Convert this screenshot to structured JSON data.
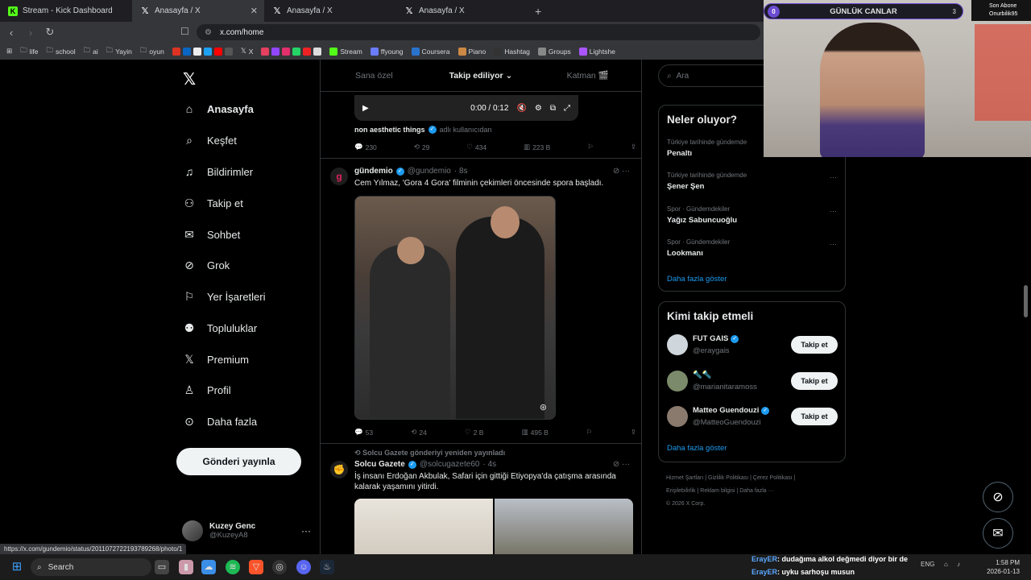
{
  "browser": {
    "tabs": [
      {
        "title": "Stream - Kick Dashboard",
        "icon": "kick-icon",
        "active": false
      },
      {
        "title": "Anasayfa / X",
        "icon": "x-icon",
        "active": true
      },
      {
        "title": "Anasayfa / X",
        "icon": "x-icon",
        "active": false
      },
      {
        "title": "Anasayfa / X",
        "icon": "x-icon",
        "active": false
      }
    ],
    "url": "x.com/home",
    "bookmarks": [
      "life",
      "school",
      "ai",
      "Yayin",
      "oyun",
      "X",
      "Stream",
      "ffyoung",
      "Coursera",
      "Piano",
      "Hashtag",
      "Groups",
      "Lightshe"
    ]
  },
  "nav": {
    "items": [
      {
        "label": "Anasayfa",
        "icon": "home-icon",
        "active": true
      },
      {
        "label": "Keşfet",
        "icon": "search-icon",
        "active": false
      },
      {
        "label": "Bildirimler",
        "icon": "bell-icon",
        "active": false
      },
      {
        "label": "Takip et",
        "icon": "add-person-icon",
        "active": false
      },
      {
        "label": "Sohbet",
        "icon": "mail-icon",
        "active": false
      },
      {
        "label": "Grok",
        "icon": "grok-icon",
        "active": false
      },
      {
        "label": "Yer İşaretleri",
        "icon": "bookmark-icon",
        "active": false
      },
      {
        "label": "Topluluklar",
        "icon": "communities-icon",
        "active": false
      },
      {
        "label": "Premium",
        "icon": "x-icon",
        "active": false
      },
      {
        "label": "Profil",
        "icon": "person-icon",
        "active": false
      },
      {
        "label": "Daha fazla",
        "icon": "more-circle-icon",
        "active": false
      }
    ],
    "post_button": "Gönderi yayınla",
    "account": {
      "name": "Kuzey Genc",
      "handle": "@KuzeyA8"
    }
  },
  "feed": {
    "tabs": [
      "Sana özel",
      "Takip ediliyor",
      "Katman 🎬"
    ],
    "video": {
      "time": "0:00 / 0:12"
    },
    "tweet0": {
      "source_name": "non aesthetic things",
      "source_suffix": "adlı kullanıcıdan",
      "replies": "230",
      "reposts": "29",
      "likes": "434",
      "views": "223 B"
    },
    "tweet1": {
      "name": "gündemio",
      "handle": "@gundemio",
      "time": "· 8s",
      "text": "Cem Yılmaz, 'Gora 4 Gora' filminin çekimleri öncesinde spora başladı.",
      "replies": "53",
      "reposts": "24",
      "likes": "2 B",
      "views": "495 B"
    },
    "tweet2": {
      "repost_note": "Solcu Gazete gönderiyi yeniden yayınladı",
      "name": "Solcu Gazete",
      "handle": "@solcugazete60",
      "time": "· 4s",
      "text": "İş insanı Erdoğan Akbulak, Safari için gittiği Etiyopya'da çatışma arasında kalarak yaşamını yitirdi."
    }
  },
  "sidebar": {
    "search_placeholder": "Ara",
    "trends_title": "Neler oluyor?",
    "trends": [
      {
        "context": "Türkiye tarihinde gündemde",
        "name": "Penaltı"
      },
      {
        "context": "Türkiye tarihinde gündemde",
        "name": "Şener Şen"
      },
      {
        "context": "Spor · Gündemdekiler",
        "name": "Yağız Sabuncuoğlu"
      },
      {
        "context": "Spor · Gündemdekiler",
        "name": "Lookmanı"
      }
    ],
    "trends_more": "Daha fazla göster",
    "follow_title": "Kimi takip etmeli",
    "follow": [
      {
        "name": "FUT GAIS",
        "handle": "@eraygais",
        "verified": true,
        "button": "Takip et"
      },
      {
        "name": "🔦🔦",
        "handle": "@marianitaramoss",
        "verified": false,
        "button": "Takip et"
      },
      {
        "name": "Matteo Guendouzi",
        "handle": "@MatteoGuendouzi",
        "verified": true,
        "button": "Takip et"
      }
    ],
    "follow_more": "Daha fazla göster",
    "footer": [
      "Hizmet Şartları",
      "Gizlilik Politikası",
      "Çerez Politikası",
      "Erişilebilirlik",
      "Reklam bilgisi",
      "Daha fazla ···",
      "© 2026 X Corp."
    ]
  },
  "overlay": {
    "counter_left": "0",
    "title": "GÜNLÜK CANLAR",
    "counter_right": "3",
    "sub_label": "Son Abone",
    "sub_name": "Onurbilik95"
  },
  "status_url": "https://x.com/gundemio/status/2011072722193789268/photo/1",
  "taskbar": {
    "search": "Search",
    "chat": [
      {
        "user": "ErayER",
        "text": ": dudağıma alkol değmedi diyor bir de"
      },
      {
        "user": "ErayER",
        "text": ": uyku sarhoşu musun"
      }
    ],
    "lang": "ENG",
    "time": "1:58 PM",
    "date": "2026-01-13"
  }
}
